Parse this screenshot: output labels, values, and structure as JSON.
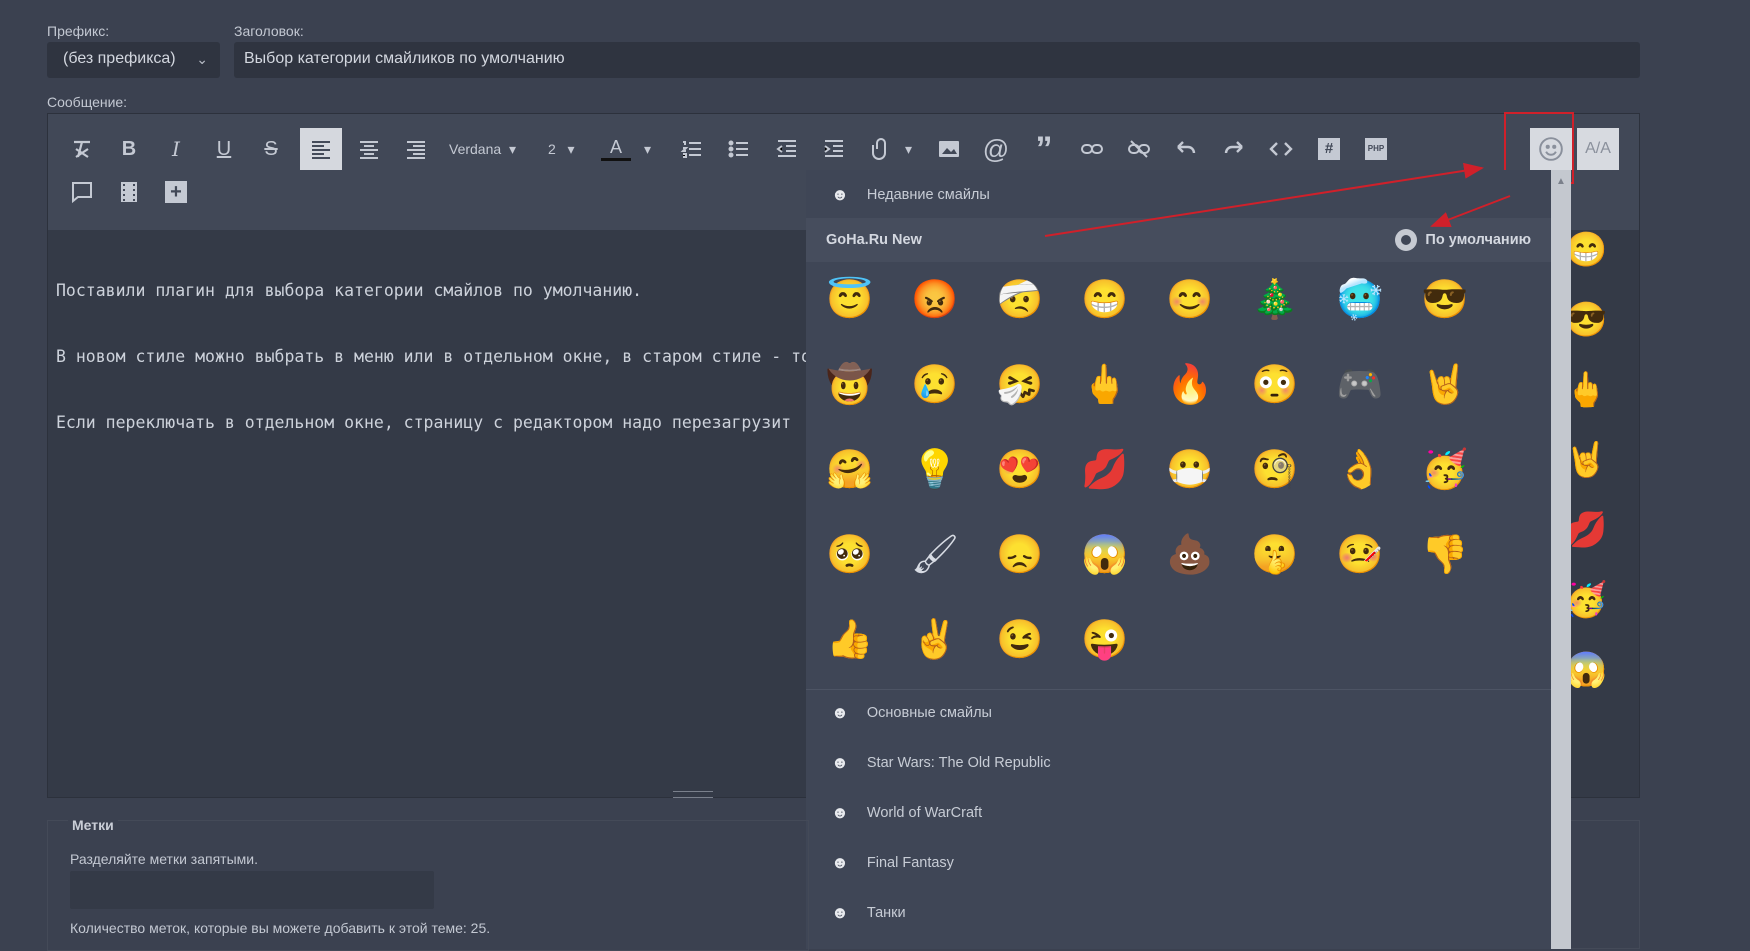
{
  "form": {
    "prefix_label": "Префикс:",
    "prefix_value": "(без префикса)",
    "title_label": "Заголовок:",
    "title_value": "Выбор категории смайликов по умолчанию",
    "message_label": "Сообщение:"
  },
  "toolbar": {
    "font_name": "Verdana",
    "font_size": "2",
    "color_letter": "A",
    "translit_label": "A/A"
  },
  "message": {
    "lines": [
      "Поставили плагин для выбора категории смайлов по умолчанию.",
      "В новом стиле можно выбрать в меню или в отдельном окне, в старом стиле - то",
      "Если переключать в отдельном окне, страницу с редактором надо перезагрузит"
    ]
  },
  "emoji_panel": {
    "recent_label": "Недавние смайлы",
    "active_category": "GoHa.Ru New",
    "default_label": "По умолчанию",
    "emojis": [
      "😇",
      "😡",
      "🤕",
      "😁",
      "😊",
      "🎄",
      "🥶",
      "😎",
      "🤠",
      "😢",
      "🤧",
      "🖕",
      "🔥",
      "😳",
      "🎮",
      "🤘",
      "🤗",
      "💡",
      "😍",
      "💋",
      "😷",
      "🧐",
      "👌",
      "🥳",
      "🥺",
      "🖌",
      "😞",
      "😱",
      "💩",
      "🤫",
      "🤒",
      "👎",
      "👍",
      "✌",
      "😉",
      "😜"
    ],
    "other_categories": [
      "Основные смайлы",
      "Star Wars: The Old Republic",
      "World of WarCraft",
      "Final Fantasy",
      "Танки"
    ]
  },
  "side_smilies": [
    "😁",
    "😎",
    "🖕",
    "🤘",
    "💋",
    "🥳",
    "😱"
  ],
  "tags": {
    "title": "Метки",
    "hint": "Разделяйте метки запятыми.",
    "count_text": "Количество меток, которые вы можете добавить к этой теме: 25."
  },
  "colors": {
    "annotation_red": "#d0202a",
    "background": "#3b4150"
  }
}
